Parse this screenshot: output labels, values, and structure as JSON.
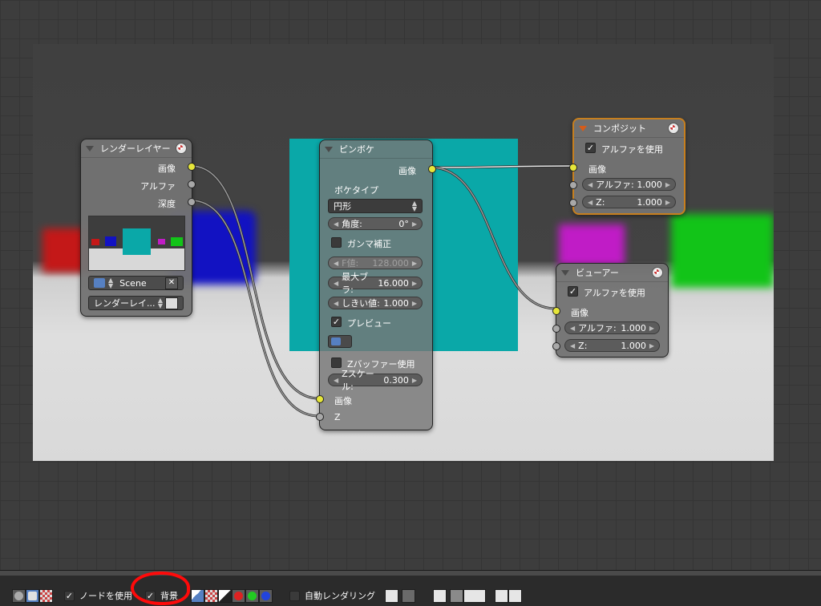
{
  "render_layers_node": {
    "title": "レンダーレイヤー",
    "outputs": [
      "画像",
      "アルファ",
      "深度"
    ],
    "scene": "Scene",
    "layer": "レンダーレイ..."
  },
  "defocus_node": {
    "title": "ピンボケ",
    "output": "画像",
    "bokeh_type_label": "ボケタイプ",
    "bokeh_type_value": "円形",
    "angle": {
      "label": "角度:",
      "value": "0°"
    },
    "gamma_correction": {
      "label": "ガンマ補正",
      "checked": false
    },
    "fstop": {
      "label": "F値:",
      "value": "128.000"
    },
    "max_blur": {
      "label": "最大ブラ:",
      "value": "16.000"
    },
    "threshold": {
      "label": "しきい値:",
      "value": "1.000"
    },
    "preview": {
      "label": "プレビュー",
      "checked": true
    },
    "use_zbuffer": {
      "label": "Zバッファー使用",
      "checked": false
    },
    "z_scale": {
      "label": "Zスケール:",
      "value": "0.300"
    },
    "inputs": [
      "画像",
      "Z"
    ]
  },
  "composite_node": {
    "title": "コンポジット",
    "use_alpha": {
      "label": "アルファを使用",
      "checked": true
    },
    "input_image": "画像",
    "alpha": {
      "label": "アルファ:",
      "value": "1.000"
    },
    "z": {
      "label": "Z:",
      "value": "1.000"
    }
  },
  "viewer_node": {
    "title": "ビューアー",
    "use_alpha": {
      "label": "アルファを使用",
      "checked": true
    },
    "input_image": "画像",
    "alpha": {
      "label": "アルファ:",
      "value": "1.000"
    },
    "z": {
      "label": "Z:",
      "value": "1.000"
    }
  },
  "toolbar": {
    "use_nodes": {
      "label": "ノードを使用",
      "checked": true
    },
    "backdrop": {
      "label": "背景",
      "checked": true
    },
    "auto_render": {
      "label": "自動レンダリング",
      "checked": false
    }
  },
  "colors": {
    "socket_image": "#e6e63a",
    "socket_value": "#a8a8a8",
    "active_node_border": "#c77f1e",
    "annotation": "#ff0a0a"
  }
}
